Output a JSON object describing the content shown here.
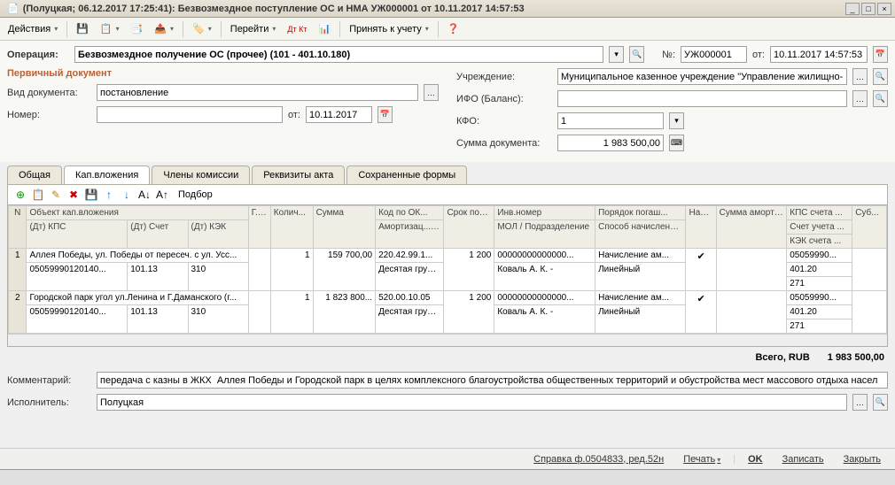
{
  "window": {
    "title": "(Полуцкая; 06.12.2017 17:25:41): Безвозмездное поступление ОС и НМА УЖ000001 от 10.11.2017 14:57:53"
  },
  "toolbar": {
    "actions": "Действия",
    "goto": "Перейти",
    "dk": "Дт Кт",
    "accept": "Принять к учету"
  },
  "header": {
    "operation_label": "Операция:",
    "operation_value": "Безвозмездное получение ОС (прочее) (101 - 401.10.180)",
    "num_label": "№:",
    "num_value": "УЖ000001",
    "from_label": "от:",
    "date_value": "10.11.2017 14:57:53"
  },
  "primary_doc": {
    "section": "Первичный документ",
    "type_label": "Вид документа:",
    "type_value": "постановление",
    "number_label": "Номер:",
    "number_value": "",
    "from_label": "от:",
    "from_date": "10.11.2017"
  },
  "right": {
    "org_label": "Учреждение:",
    "org_value": "Муниципальное казенное учреждение \"Управление жилищно-коммунального",
    "ifo_label": "ИФО (Баланс):",
    "ifo_value": "",
    "kfo_label": "КФО:",
    "kfo_value": "1",
    "sum_label": "Сумма документа:",
    "sum_value": "1 983 500,00"
  },
  "tabs": [
    "Общая",
    "Кап.вложения",
    "Члены комиссии",
    "Реквизиты акта",
    "Сохраненные формы"
  ],
  "grid_toolbar": {
    "pick": "Подбор"
  },
  "grid": {
    "headers": {
      "n": "N",
      "obj": "Объект кап.вложения",
      "g": "Г... у...",
      "qty": "Колич...",
      "sum": "Сумма",
      "ok": "Код по ОК...",
      "srok": "Срок полезн... испо...",
      "inv": "Инв.номер",
      "poryadok": "Порядок погаш...",
      "nach": "Нач... амо...",
      "sam": "Сумма амортизации",
      "kps": "КПС счета ...",
      "sub": "Суб...",
      "dtkps": "(Дт) КПС",
      "dtsch": "(Дт) Счет",
      "dtkek": "(Дт) КЭК",
      "amort": "Амортизац... группа",
      "mol": "МОЛ / Подразделение",
      "sposob": "Способ начисления ...",
      "schy": "Счет учета ...",
      "kek2": "КЭК счета ..."
    },
    "rows": [
      {
        "n": "1",
        "obj": "Аллея Победы, ул. Победы от пересеч. с ул. Усс...",
        "kps": "05059990120140...",
        "sch": "101.13",
        "kek": "310",
        "qty": "1",
        "sum": "159 700,00",
        "ok": "220.42.99.1...",
        "srok": "1 200",
        "inv": "00000000000000...",
        "por": "Начисление ам...",
        "nach": "✔",
        "amortg": "Десятая группа ...",
        "mol": "Коваль А. К. -",
        "sposob": "Линейный",
        "kps2": "05059990...",
        "schu": "401.20",
        "kek2": "271"
      },
      {
        "n": "2",
        "obj": "Городской парк угол ул.Ленина и Г.Даманского (г...",
        "kps": "05059990120140...",
        "sch": "101.13",
        "kek": "310",
        "qty": "1",
        "sum": "1 823 800...",
        "ok": "520.00.10.05",
        "srok": "1 200",
        "inv": "00000000000000...",
        "por": "Начисление ам...",
        "nach": "✔",
        "amortg": "Десятая группа ...",
        "mol": "Коваль А. К. -",
        "sposob": "Линейный",
        "kps2": "05059990...",
        "schu": "401.20",
        "kek2": "271"
      }
    ]
  },
  "totals": {
    "label": "Всего, RUB",
    "value": "1 983 500,00"
  },
  "bottom": {
    "comment_label": "Комментарий:",
    "comment_value": "передача с казны в ЖКХ  Аллея Победы и Городской парк в целях комплексного благоустройства общественных территорий и обустройства мест массового отдыха насел",
    "exec_label": "Исполнитель:",
    "exec_value": "Полуцкая"
  },
  "footer": {
    "help": "Справка ф.0504833, ред.52н",
    "print": "Печать",
    "ok": "OK",
    "save": "Записать",
    "close": "Закрыть"
  }
}
